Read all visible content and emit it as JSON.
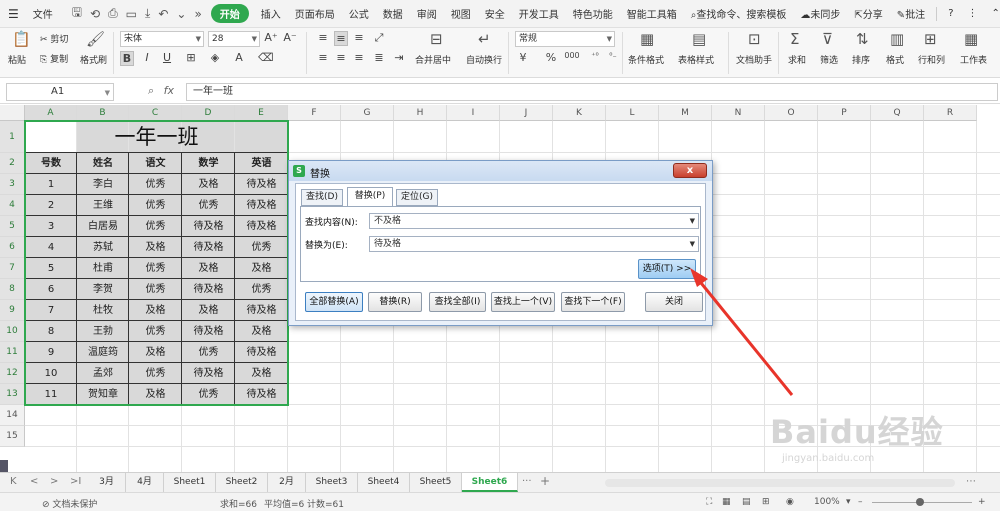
{
  "menubar": {
    "file": "文件",
    "tabs": [
      "开始",
      "插入",
      "页面布局",
      "公式",
      "数据",
      "审阅",
      "视图",
      "安全",
      "开发工具",
      "特色功能",
      "智能工具箱"
    ],
    "active_tab": "开始",
    "search": "查找命令、搜索模板",
    "sync": "未同步",
    "share": "分享",
    "comment": "批注",
    "help": "?"
  },
  "ribbon": {
    "paste": "粘贴",
    "cut": "剪切",
    "copy": "复制",
    "format_painter": "格式刷",
    "font_name": "宋体",
    "font_size": "28",
    "bold": "B",
    "italic": "I",
    "underline": "U",
    "merge_center": "合并居中",
    "wrap_text": "自动换行",
    "number_format": "常规",
    "percent": "%",
    "thousands": "000",
    "cond_format": "条件格式",
    "table_style": "表格样式",
    "doc_helper": "文档助手",
    "sum": "求和",
    "filter": "筛选",
    "sort": "排序",
    "format": "格式",
    "rows_cols": "行和列",
    "worksheet": "工作表"
  },
  "formula_bar": {
    "cell_ref": "A1",
    "fx": "fx",
    "content": "一年一班"
  },
  "columns": [
    "A",
    "B",
    "C",
    "D",
    "E",
    "F",
    "G",
    "H",
    "I",
    "J",
    "K",
    "L",
    "M",
    "N",
    "O",
    "P",
    "Q",
    "R"
  ],
  "rows": [
    "1",
    "2",
    "3",
    "4",
    "5",
    "6",
    "7",
    "8",
    "9",
    "10",
    "11",
    "12",
    "13",
    "14",
    "15"
  ],
  "table": {
    "title": "一年一班",
    "headers": [
      "号数",
      "姓名",
      "语文",
      "数学",
      "英语"
    ],
    "rows": [
      [
        "1",
        "李白",
        "优秀",
        "及格",
        "待及格"
      ],
      [
        "2",
        "王维",
        "优秀",
        "优秀",
        "待及格"
      ],
      [
        "3",
        "白居易",
        "优秀",
        "待及格",
        "待及格"
      ],
      [
        "4",
        "苏轼",
        "及格",
        "待及格",
        "优秀"
      ],
      [
        "5",
        "杜甫",
        "优秀",
        "及格",
        "及格"
      ],
      [
        "6",
        "李贺",
        "优秀",
        "待及格",
        "优秀"
      ],
      [
        "7",
        "杜牧",
        "及格",
        "及格",
        "待及格"
      ],
      [
        "8",
        "王勃",
        "优秀",
        "待及格",
        "及格"
      ],
      [
        "9",
        "温庭筠",
        "及格",
        "优秀",
        "待及格"
      ],
      [
        "10",
        "孟郊",
        "优秀",
        "待及格",
        "及格"
      ],
      [
        "11",
        "贺知章",
        "及格",
        "优秀",
        "待及格"
      ]
    ]
  },
  "dialog": {
    "title": "替换",
    "close": "x",
    "tabs": [
      "查找(D)",
      "替换(P)",
      "定位(G)"
    ],
    "active_tab": "替换(P)",
    "find_label": "查找内容(N):",
    "find_value": "不及格",
    "replace_label": "替换为(E):",
    "replace_value": "待及格",
    "options_button": "选项(T) >>",
    "buttons": [
      "全部替换(A)",
      "替换(R)",
      "查找全部(I)",
      "查找上一个(V)",
      "查找下一个(F)",
      "关闭"
    ]
  },
  "sheet_tabs": [
    "3月",
    "4月",
    "Sheet1",
    "Sheet2",
    "2月",
    "Sheet3",
    "Sheet4",
    "Sheet5",
    "Sheet6"
  ],
  "active_sheet": "Sheet6",
  "add_sheet": "+",
  "more_sheets": "···",
  "status": {
    "protect": "文档未保护",
    "sum": "求和=66",
    "average": "平均值=6",
    "count": "计数=61",
    "zoom": "100%"
  },
  "watermark": {
    "big": "Baidu经验",
    "small": "jingyan.baidu.com"
  },
  "colors": {
    "accent": "#2fa84f",
    "arrow": "#e8342a",
    "dialog_bg": "#e9f0f9"
  }
}
